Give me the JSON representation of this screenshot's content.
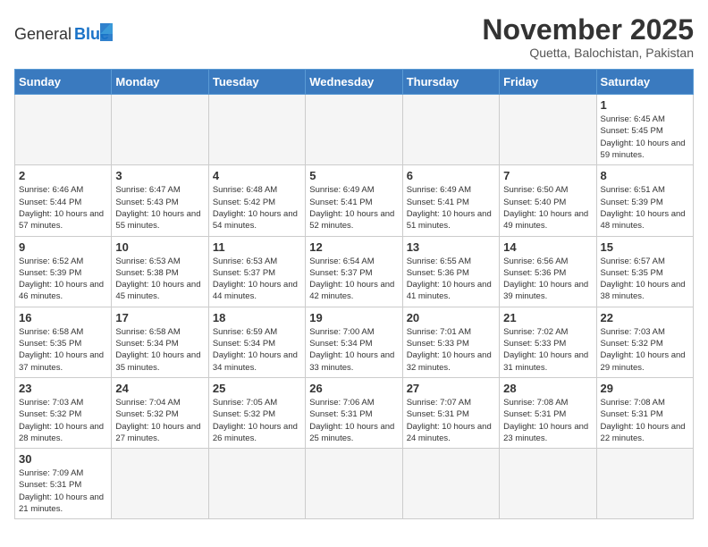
{
  "header": {
    "logo_general": "General",
    "logo_blue": "Blue",
    "month_title": "November 2025",
    "subtitle": "Quetta, Balochistan, Pakistan"
  },
  "weekdays": [
    "Sunday",
    "Monday",
    "Tuesday",
    "Wednesday",
    "Thursday",
    "Friday",
    "Saturday"
  ],
  "days": [
    {
      "date": null,
      "number": "",
      "sunrise": "",
      "sunset": "",
      "daylight": ""
    },
    {
      "date": null,
      "number": "",
      "sunrise": "",
      "sunset": "",
      "daylight": ""
    },
    {
      "date": null,
      "number": "",
      "sunrise": "",
      "sunset": "",
      "daylight": ""
    },
    {
      "date": null,
      "number": "",
      "sunrise": "",
      "sunset": "",
      "daylight": ""
    },
    {
      "date": null,
      "number": "",
      "sunrise": "",
      "sunset": "",
      "daylight": ""
    },
    {
      "date": null,
      "number": "",
      "sunrise": "",
      "sunset": "",
      "daylight": ""
    },
    {
      "number": "1",
      "sunrise": "Sunrise: 6:45 AM",
      "sunset": "Sunset: 5:45 PM",
      "daylight": "Daylight: 10 hours and 59 minutes."
    },
    {
      "number": "2",
      "sunrise": "Sunrise: 6:46 AM",
      "sunset": "Sunset: 5:44 PM",
      "daylight": "Daylight: 10 hours and 57 minutes."
    },
    {
      "number": "3",
      "sunrise": "Sunrise: 6:47 AM",
      "sunset": "Sunset: 5:43 PM",
      "daylight": "Daylight: 10 hours and 55 minutes."
    },
    {
      "number": "4",
      "sunrise": "Sunrise: 6:48 AM",
      "sunset": "Sunset: 5:42 PM",
      "daylight": "Daylight: 10 hours and 54 minutes."
    },
    {
      "number": "5",
      "sunrise": "Sunrise: 6:49 AM",
      "sunset": "Sunset: 5:41 PM",
      "daylight": "Daylight: 10 hours and 52 minutes."
    },
    {
      "number": "6",
      "sunrise": "Sunrise: 6:49 AM",
      "sunset": "Sunset: 5:41 PM",
      "daylight": "Daylight: 10 hours and 51 minutes."
    },
    {
      "number": "7",
      "sunrise": "Sunrise: 6:50 AM",
      "sunset": "Sunset: 5:40 PM",
      "daylight": "Daylight: 10 hours and 49 minutes."
    },
    {
      "number": "8",
      "sunrise": "Sunrise: 6:51 AM",
      "sunset": "Sunset: 5:39 PM",
      "daylight": "Daylight: 10 hours and 48 minutes."
    },
    {
      "number": "9",
      "sunrise": "Sunrise: 6:52 AM",
      "sunset": "Sunset: 5:39 PM",
      "daylight": "Daylight: 10 hours and 46 minutes."
    },
    {
      "number": "10",
      "sunrise": "Sunrise: 6:53 AM",
      "sunset": "Sunset: 5:38 PM",
      "daylight": "Daylight: 10 hours and 45 minutes."
    },
    {
      "number": "11",
      "sunrise": "Sunrise: 6:53 AM",
      "sunset": "Sunset: 5:37 PM",
      "daylight": "Daylight: 10 hours and 44 minutes."
    },
    {
      "number": "12",
      "sunrise": "Sunrise: 6:54 AM",
      "sunset": "Sunset: 5:37 PM",
      "daylight": "Daylight: 10 hours and 42 minutes."
    },
    {
      "number": "13",
      "sunrise": "Sunrise: 6:55 AM",
      "sunset": "Sunset: 5:36 PM",
      "daylight": "Daylight: 10 hours and 41 minutes."
    },
    {
      "number": "14",
      "sunrise": "Sunrise: 6:56 AM",
      "sunset": "Sunset: 5:36 PM",
      "daylight": "Daylight: 10 hours and 39 minutes."
    },
    {
      "number": "15",
      "sunrise": "Sunrise: 6:57 AM",
      "sunset": "Sunset: 5:35 PM",
      "daylight": "Daylight: 10 hours and 38 minutes."
    },
    {
      "number": "16",
      "sunrise": "Sunrise: 6:58 AM",
      "sunset": "Sunset: 5:35 PM",
      "daylight": "Daylight: 10 hours and 37 minutes."
    },
    {
      "number": "17",
      "sunrise": "Sunrise: 6:58 AM",
      "sunset": "Sunset: 5:34 PM",
      "daylight": "Daylight: 10 hours and 35 minutes."
    },
    {
      "number": "18",
      "sunrise": "Sunrise: 6:59 AM",
      "sunset": "Sunset: 5:34 PM",
      "daylight": "Daylight: 10 hours and 34 minutes."
    },
    {
      "number": "19",
      "sunrise": "Sunrise: 7:00 AM",
      "sunset": "Sunset: 5:34 PM",
      "daylight": "Daylight: 10 hours and 33 minutes."
    },
    {
      "number": "20",
      "sunrise": "Sunrise: 7:01 AM",
      "sunset": "Sunset: 5:33 PM",
      "daylight": "Daylight: 10 hours and 32 minutes."
    },
    {
      "number": "21",
      "sunrise": "Sunrise: 7:02 AM",
      "sunset": "Sunset: 5:33 PM",
      "daylight": "Daylight: 10 hours and 31 minutes."
    },
    {
      "number": "22",
      "sunrise": "Sunrise: 7:03 AM",
      "sunset": "Sunset: 5:32 PM",
      "daylight": "Daylight: 10 hours and 29 minutes."
    },
    {
      "number": "23",
      "sunrise": "Sunrise: 7:03 AM",
      "sunset": "Sunset: 5:32 PM",
      "daylight": "Daylight: 10 hours and 28 minutes."
    },
    {
      "number": "24",
      "sunrise": "Sunrise: 7:04 AM",
      "sunset": "Sunset: 5:32 PM",
      "daylight": "Daylight: 10 hours and 27 minutes."
    },
    {
      "number": "25",
      "sunrise": "Sunrise: 7:05 AM",
      "sunset": "Sunset: 5:32 PM",
      "daylight": "Daylight: 10 hours and 26 minutes."
    },
    {
      "number": "26",
      "sunrise": "Sunrise: 7:06 AM",
      "sunset": "Sunset: 5:31 PM",
      "daylight": "Daylight: 10 hours and 25 minutes."
    },
    {
      "number": "27",
      "sunrise": "Sunrise: 7:07 AM",
      "sunset": "Sunset: 5:31 PM",
      "daylight": "Daylight: 10 hours and 24 minutes."
    },
    {
      "number": "28",
      "sunrise": "Sunrise: 7:08 AM",
      "sunset": "Sunset: 5:31 PM",
      "daylight": "Daylight: 10 hours and 23 minutes."
    },
    {
      "number": "29",
      "sunrise": "Sunrise: 7:08 AM",
      "sunset": "Sunset: 5:31 PM",
      "daylight": "Daylight: 10 hours and 22 minutes."
    },
    {
      "number": "30",
      "sunrise": "Sunrise: 7:09 AM",
      "sunset": "Sunset: 5:31 PM",
      "daylight": "Daylight: 10 hours and 21 minutes."
    },
    {
      "date": null,
      "number": "",
      "sunrise": "",
      "sunset": "",
      "daylight": ""
    },
    {
      "date": null,
      "number": "",
      "sunrise": "",
      "sunset": "",
      "daylight": ""
    },
    {
      "date": null,
      "number": "",
      "sunrise": "",
      "sunset": "",
      "daylight": ""
    },
    {
      "date": null,
      "number": "",
      "sunrise": "",
      "sunset": "",
      "daylight": ""
    },
    {
      "date": null,
      "number": "",
      "sunrise": "",
      "sunset": "",
      "daylight": ""
    },
    {
      "date": null,
      "number": "",
      "sunrise": "",
      "sunset": "",
      "daylight": ""
    }
  ]
}
